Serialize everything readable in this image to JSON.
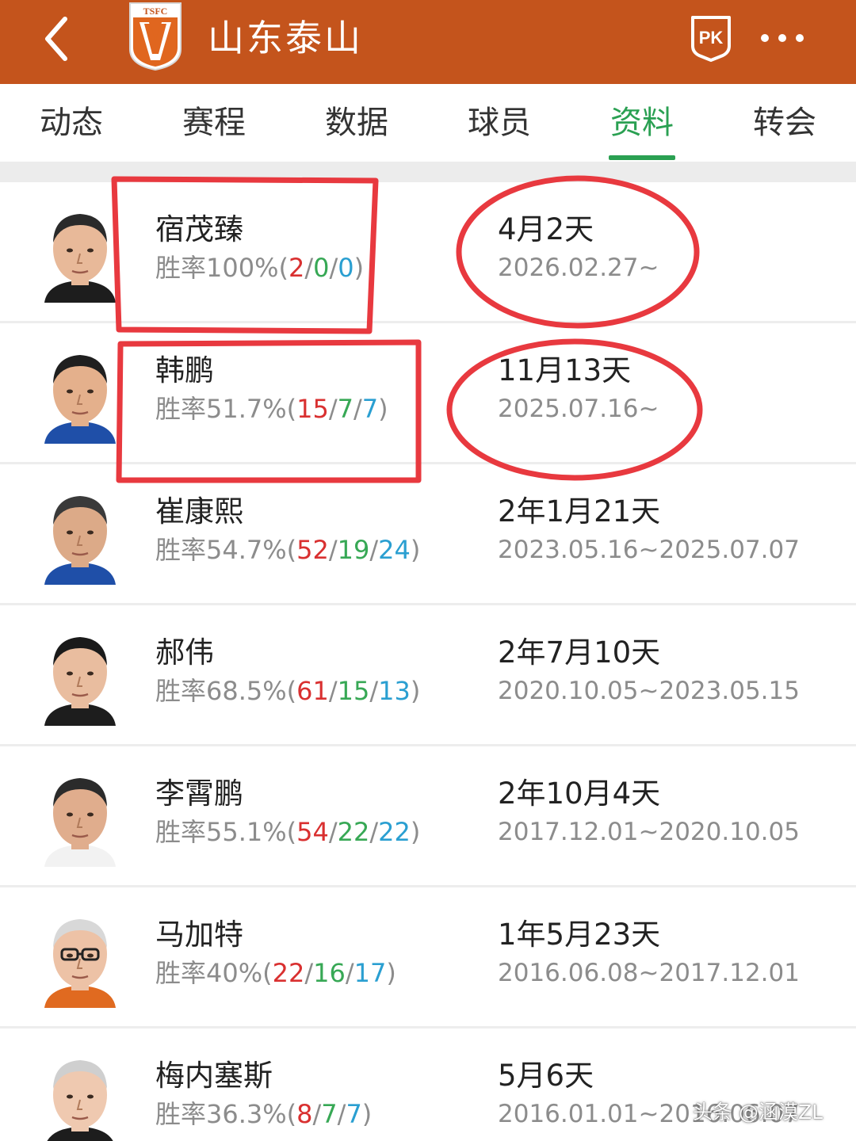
{
  "header": {
    "team_name": "山东泰山",
    "logo_text": "TSFC",
    "pk_label": "PK",
    "colors": {
      "bar": "#c4541c",
      "logo_orange": "#e0661f"
    }
  },
  "tabs": [
    {
      "label": "动态",
      "active": false
    },
    {
      "label": "赛程",
      "active": false
    },
    {
      "label": "数据",
      "active": false
    },
    {
      "label": "球员",
      "active": false
    },
    {
      "label": "资料",
      "active": true
    },
    {
      "label": "转会",
      "active": false
    }
  ],
  "coaches": [
    {
      "name": "宿茂臻",
      "win_rate_prefix": "胜率100%(",
      "wins": "2",
      "draws": "0",
      "losses": "0",
      "suffix": ")",
      "tenure": "4月2天",
      "period": "2026.02.27~"
    },
    {
      "name": "韩鹏",
      "win_rate_prefix": "胜率51.7%(",
      "wins": "15",
      "draws": "7",
      "losses": "7",
      "suffix": ")",
      "tenure": "11月13天",
      "period": "2025.07.16~"
    },
    {
      "name": "崔康熙",
      "win_rate_prefix": "胜率54.7%(",
      "wins": "52",
      "draws": "19",
      "losses": "24",
      "suffix": ")",
      "tenure": "2年1月21天",
      "period": "2023.05.16~2025.07.07"
    },
    {
      "name": "郝伟",
      "win_rate_prefix": "胜率68.5%(",
      "wins": "61",
      "draws": "15",
      "losses": "13",
      "suffix": ")",
      "tenure": "2年7月10天",
      "period": "2020.10.05~2023.05.15"
    },
    {
      "name": "李霄鹏",
      "win_rate_prefix": "胜率55.1%(",
      "wins": "54",
      "draws": "22",
      "losses": "22",
      "suffix": ")",
      "tenure": "2年10月4天",
      "period": "2017.12.01~2020.10.05"
    },
    {
      "name": "马加特",
      "win_rate_prefix": "胜率40%(",
      "wins": "22",
      "draws": "16",
      "losses": "17",
      "suffix": ")",
      "tenure": "1年5月23天",
      "period": "2016.06.08~2017.12.01"
    },
    {
      "name": "梅内塞斯",
      "win_rate_prefix": "胜率36.3%(",
      "wins": "8",
      "draws": "7",
      "losses": "7",
      "suffix": ")",
      "tenure": "5月6天",
      "period": "2016.01.01~2016.06.07"
    }
  ],
  "stat_separator": "/",
  "watermark": "头条 @涵漠ZL",
  "stat_colors": {
    "win": "#d93030",
    "draw": "#37a855",
    "loss": "#2a9fd1"
  },
  "annotation_color": "#e8393f"
}
